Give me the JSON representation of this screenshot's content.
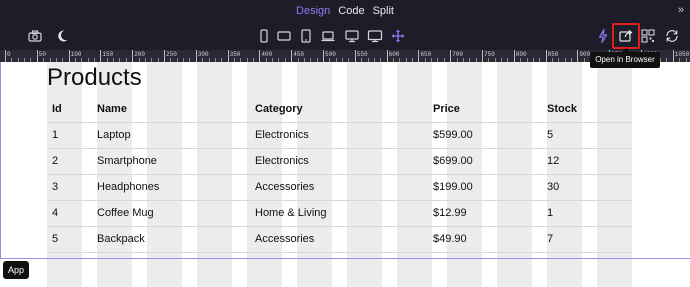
{
  "modes": [
    "Design",
    "Code",
    "Split"
  ],
  "active_mode": "Design",
  "expand_label": "»",
  "tooltip_text": "Open in Browser",
  "app_badge": "App",
  "heading": "Products",
  "ruler_labels": [
    "0",
    "50",
    "100",
    "150",
    "200",
    "250",
    "300",
    "350",
    "400",
    "450",
    "500",
    "550",
    "600",
    "650",
    "700",
    "750",
    "800",
    "850",
    "900",
    "950",
    "1000",
    "1050"
  ],
  "table": {
    "columns": [
      "Id",
      "Name",
      "Category",
      "Price",
      "Stock"
    ],
    "rows": [
      [
        "1",
        "Laptop",
        "Electronics",
        "$599.00",
        "5"
      ],
      [
        "2",
        "Smartphone",
        "Electronics",
        "$699.00",
        "12"
      ],
      [
        "3",
        "Headphones",
        "Accessories",
        "$199.00",
        "30"
      ],
      [
        "4",
        "Coffee Mug",
        "Home & Living",
        "$12.99",
        "1"
      ],
      [
        "5",
        "Backpack",
        "Accessories",
        "$49.90",
        "7"
      ]
    ]
  },
  "colors": {
    "accent": "#8e7cf5",
    "highlight": "#e02020",
    "frame": "#9b8ff0"
  },
  "icons": [
    "camera-icon",
    "moon-icon",
    "phone-icon",
    "tablet-landscape-icon",
    "tablet-icon",
    "laptop-icon",
    "desktop-icon",
    "monitor-icon",
    "move-icon",
    "lightning-icon",
    "open-in-browser-icon",
    "qr-code-icon",
    "refresh-icon"
  ]
}
